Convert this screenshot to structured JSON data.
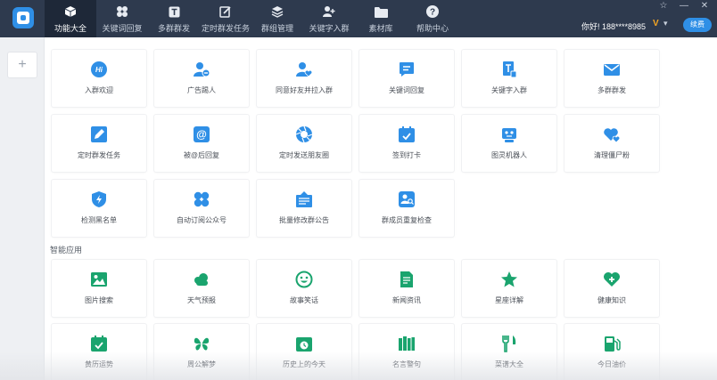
{
  "header": {
    "tabs": [
      {
        "label": "功能大全",
        "icon": "cube-icon",
        "active": true
      },
      {
        "label": "关键词回复",
        "icon": "clover-icon"
      },
      {
        "label": "多群群发",
        "icon": "text-box-icon"
      },
      {
        "label": "定时群发任务",
        "icon": "edit-doc-icon"
      },
      {
        "label": "群组管理",
        "icon": "layers-icon"
      },
      {
        "label": "关键字入群",
        "icon": "user-add-icon"
      },
      {
        "label": "素材库",
        "icon": "folder-icon"
      },
      {
        "label": "帮助中心",
        "icon": "help-icon"
      }
    ],
    "greeting": "你好! 188****8985",
    "vip_badge": "V",
    "renew_label": "续费"
  },
  "sidebar": {
    "add_label": "+"
  },
  "features": [
    {
      "label": "入群欢迎",
      "icon": "hi-bubble-icon",
      "color": "#2f8fe6"
    },
    {
      "label": "广告踢人",
      "icon": "user-remove-icon",
      "color": "#2f8fe6"
    },
    {
      "label": "同意好友并拉入群",
      "icon": "user-heart-icon",
      "color": "#2f8fe6"
    },
    {
      "label": "关键词回复",
      "icon": "chat-icon",
      "color": "#2f8fe6"
    },
    {
      "label": "关键字入群",
      "icon": "doc-t-icon",
      "color": "#2f8fe6"
    },
    {
      "label": "多群群发",
      "icon": "mail-icon",
      "color": "#2f8fe6"
    },
    {
      "label": "定时群发任务",
      "icon": "edit-box-icon",
      "color": "#2f8fe6"
    },
    {
      "label": "被@后回复",
      "icon": "at-icon",
      "color": "#2f8fe6"
    },
    {
      "label": "定时发送朋友圈",
      "icon": "aperture-icon",
      "color": "#2f8fe6"
    },
    {
      "label": "签到打卡",
      "icon": "calendar-check-icon",
      "color": "#2f8fe6"
    },
    {
      "label": "图灵机器人",
      "icon": "robot-icon",
      "color": "#2f8fe6"
    },
    {
      "label": "清理僵尸粉",
      "icon": "hearts-icon",
      "color": "#2f8fe6"
    },
    {
      "label": "检测黑名单",
      "icon": "shield-bolt-icon",
      "color": "#2f8fe6"
    },
    {
      "label": "自动订阅公众号",
      "icon": "clover-icon",
      "color": "#2f8fe6"
    },
    {
      "label": "批量修改群公告",
      "icon": "notice-board-icon",
      "color": "#2f8fe6"
    },
    {
      "label": "群成员重复检查",
      "icon": "group-search-icon",
      "color": "#2f8fe6"
    }
  ],
  "smart_section": {
    "title": "智能应用",
    "apps": [
      {
        "label": "图片搜索",
        "icon": "image-icon",
        "color": "#1aa46e"
      },
      {
        "label": "天气预报",
        "icon": "cloud-icon",
        "color": "#1aa46e"
      },
      {
        "label": "故事笑话",
        "icon": "smile-icon",
        "color": "#1aa46e"
      },
      {
        "label": "新闻资讯",
        "icon": "news-icon",
        "color": "#1aa46e"
      },
      {
        "label": "星座详解",
        "icon": "star-icon",
        "color": "#1aa46e"
      },
      {
        "label": "健康知识",
        "icon": "heart-plus-icon",
        "color": "#1aa46e"
      },
      {
        "label": "黄历运势",
        "icon": "calendar-icon",
        "color": "#1aa46e"
      },
      {
        "label": "周公解梦",
        "icon": "butterfly-icon",
        "color": "#1aa46e"
      },
      {
        "label": "历史上的今天",
        "icon": "history-calendar-icon",
        "color": "#1aa46e"
      },
      {
        "label": "名言警句",
        "icon": "books-icon",
        "color": "#1aa46e"
      },
      {
        "label": "菜谱大全",
        "icon": "utensils-icon",
        "color": "#1aa46e"
      },
      {
        "label": "今日油价",
        "icon": "fuel-icon",
        "color": "#1aa46e"
      }
    ]
  }
}
